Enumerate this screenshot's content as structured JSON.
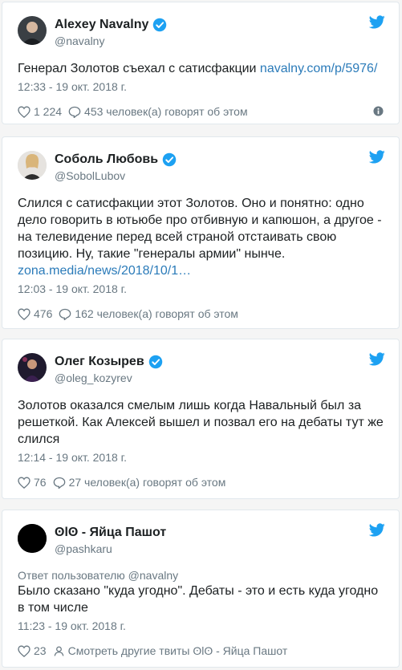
{
  "colors": {
    "accent": "#1da1f2",
    "link": "#2b7bb9",
    "meta": "#697882"
  },
  "tweets": [
    {
      "name": "Alexey Navalny",
      "handle": "@navalny",
      "text": "Генерал Золотов съехал с сатисфакции ",
      "link": "navalny.com/p/5976/",
      "time": "12:33 - 19 окт. 2018 г.",
      "likes": "1 224",
      "replies": "453 человек(а) говорят об этом"
    },
    {
      "name": "Соболь Любовь",
      "handle": "@SobolLubov",
      "text": "Слился с сатисфакции этот Золотов. Оно и понятно: одно дело говорить в ютьюбе про отбивную и капюшон, а другое - на телевидение перед всей страной отстаивать свою позицию. Ну, такие \"генералы армии\" нынче.",
      "link": "zona.media/news/2018/10/1…",
      "time": "12:03 - 19 окт. 2018 г.",
      "likes": "476",
      "replies": "162 человек(а) говорят об этом"
    },
    {
      "name": "Олег Козырев",
      "handle": "@oleg_kozyrev",
      "text": "Золотов оказался смелым лишь когда Навальный был за решеткой. Как Алексей вышел и позвал его на дебаты тут же слился",
      "time": "12:14 - 19 окт. 2018 г.",
      "likes": "76",
      "replies": "27 человек(а) говорят об этом"
    },
    {
      "name": "ʘlʘ - Яйца Пашот",
      "handle": "@pashkaru",
      "reply_to": "Ответ пользователю @navalny",
      "text": "Было сказано \"куда угодно\". Дебаты - это и есть куда угодно в том числе",
      "time": "11:23 - 19 окт. 2018 г.",
      "likes": "23",
      "more": "Смотреть другие твиты ʘlʘ - Яйца Пашот"
    }
  ]
}
